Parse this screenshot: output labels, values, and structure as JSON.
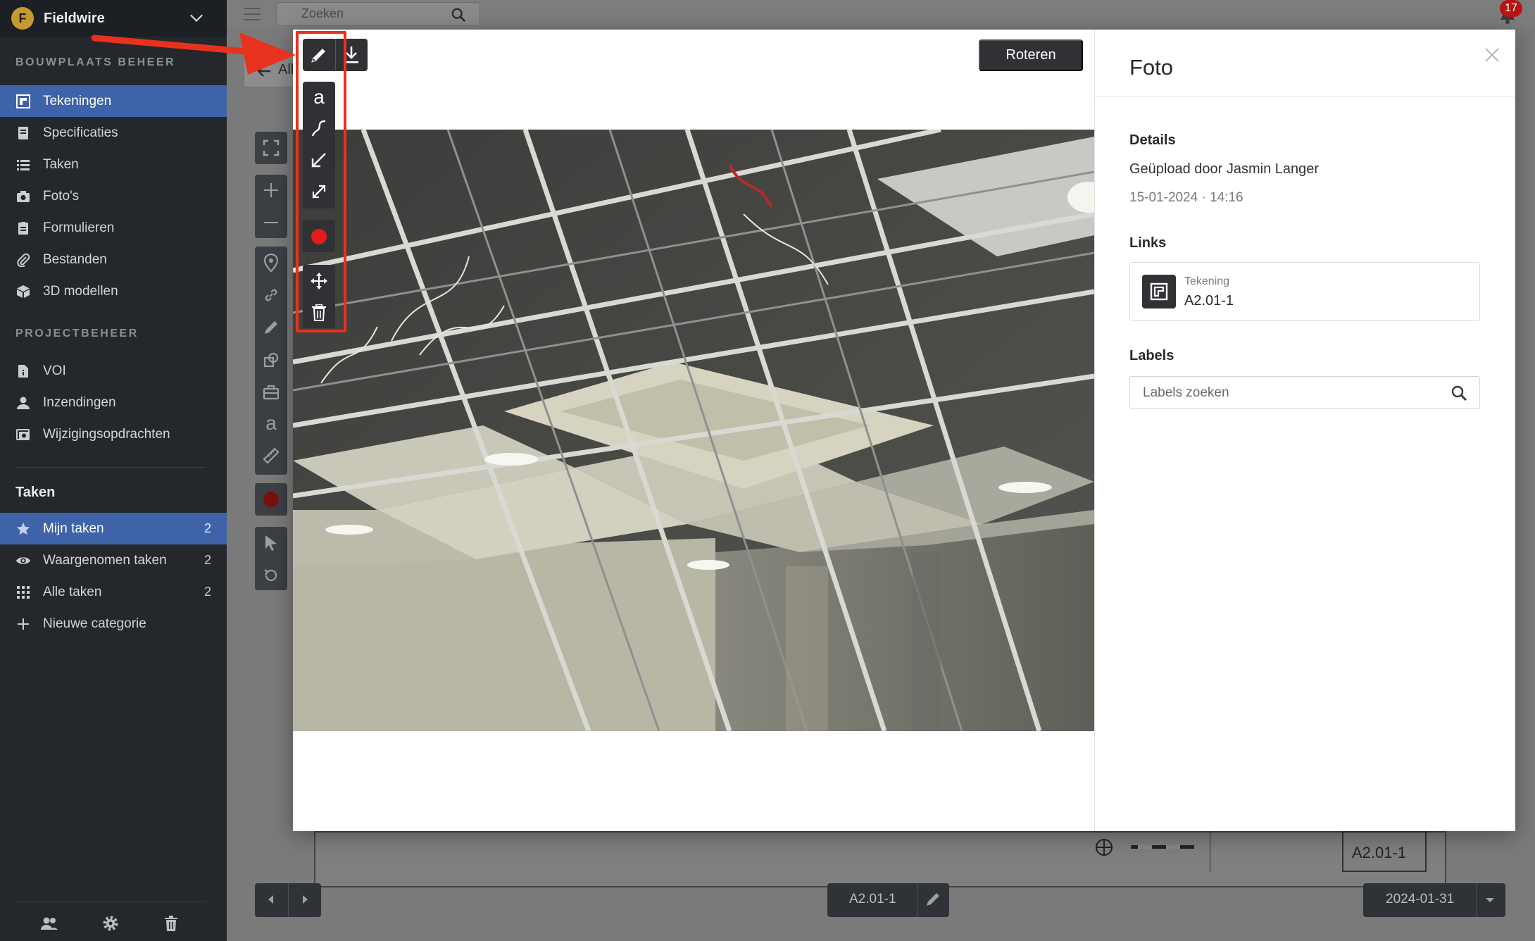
{
  "app": {
    "name": "Fieldwire",
    "logo_letter": "F"
  },
  "sidebar": {
    "section_site": "BOUWPLAATS BEHEER",
    "site_items": [
      {
        "label": "Tekeningen",
        "icon": "drawings-icon",
        "active": true
      },
      {
        "label": "Specificaties",
        "icon": "book-icon"
      },
      {
        "label": "Taken",
        "icon": "list-icon"
      },
      {
        "label": "Foto's",
        "icon": "camera-icon"
      },
      {
        "label": "Formulieren",
        "icon": "clipboard-icon"
      },
      {
        "label": "Bestanden",
        "icon": "paperclip-icon"
      },
      {
        "label": "3D modellen",
        "icon": "cube-icon"
      }
    ],
    "section_project": "PROJECTBEHEER",
    "project_items": [
      {
        "label": "VOI",
        "icon": "document-icon"
      },
      {
        "label": "Inzendingen",
        "icon": "person-icon"
      },
      {
        "label": "Wijzigingsopdrachten",
        "icon": "change-order-icon"
      }
    ],
    "tasks_title": "Taken",
    "task_items": [
      {
        "label": "Mijn taken",
        "count": "2",
        "icon": "star-icon",
        "active": true
      },
      {
        "label": "Waargenomen taken",
        "count": "2",
        "icon": "eye-icon"
      },
      {
        "label": "Alle taken",
        "count": "2",
        "icon": "grid-icon"
      },
      {
        "label": "Nieuwe categorie",
        "icon": "plus-icon"
      }
    ]
  },
  "topbar": {
    "search_placeholder": "Zoeken",
    "notification_count": "17"
  },
  "background": {
    "back_label": "All",
    "sheet_number": "A2.01-1",
    "sheet_selector": "A2.01-1",
    "date_selector": "2024-01-31"
  },
  "modal": {
    "rotate_label": "Roteren",
    "panel_title": "Foto",
    "details_label": "Details",
    "uploaded_by": "Geüpload door Jasmin Langer",
    "uploaded_date": "15-01-2024 · 14:16",
    "links_label": "Links",
    "link_type": "Tekening",
    "link_name": "A2.01-1",
    "labels_label": "Labels",
    "labels_placeholder": "Labels zoeken",
    "annotation_color": "#e51b1b",
    "highlight_color": "#e8321e"
  }
}
